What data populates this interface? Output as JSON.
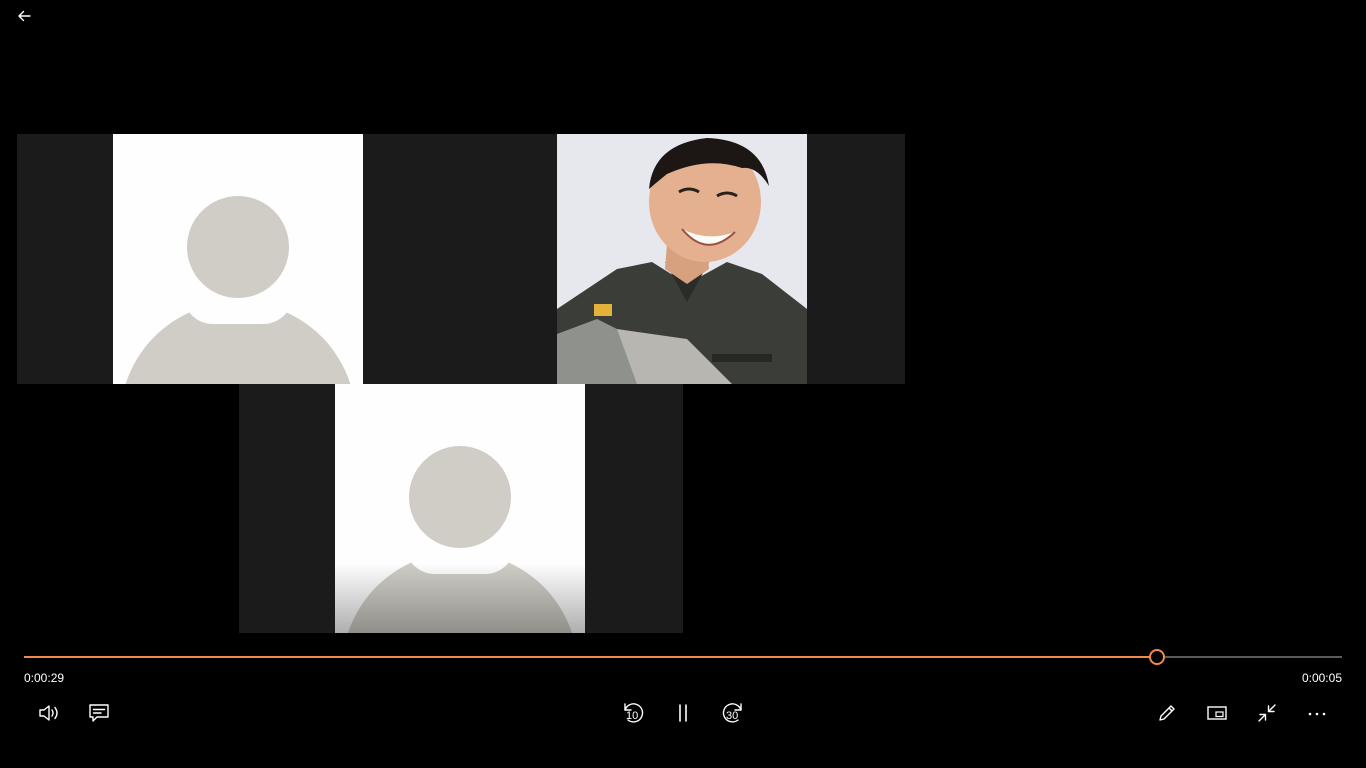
{
  "player": {
    "elapsed": "0:00:29",
    "remaining": "0:00:05",
    "progress_fraction": 0.86,
    "accent_color": "#f08a4b"
  },
  "controls": {
    "back_icon": "arrow-left-icon",
    "volume_icon": "volume-icon",
    "captions_icon": "captions-icon",
    "rewind_icon": "rewind-10-icon",
    "rewind_label": "10",
    "play_pause_icon": "pause-icon",
    "forward_icon": "forward-30-icon",
    "forward_label": "30",
    "edit_icon": "pencil-icon",
    "miniview_icon": "mini-view-icon",
    "exit_fullscreen_icon": "exit-fullscreen-icon",
    "more_icon": "more-icon"
  },
  "video": {
    "participants": [
      {
        "kind": "avatar-placeholder"
      },
      {
        "kind": "camera-feed"
      },
      {
        "kind": "avatar-placeholder"
      }
    ]
  }
}
